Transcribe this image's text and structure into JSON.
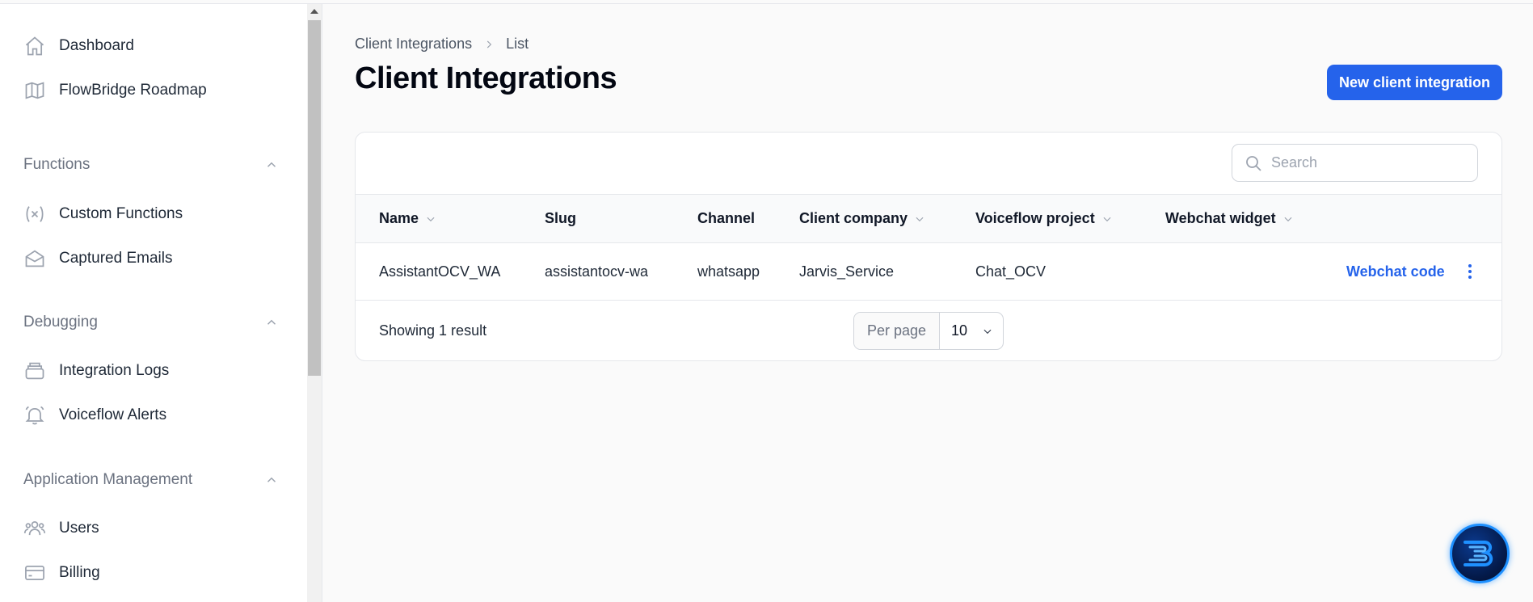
{
  "sidebar": {
    "items_top": [
      {
        "label": "Dashboard",
        "icon": "home-icon"
      },
      {
        "label": "FlowBridge Roadmap",
        "icon": "map-icon"
      }
    ],
    "groups": [
      {
        "title": "Functions",
        "items": [
          {
            "label": "Custom Functions",
            "icon": "variable-icon"
          },
          {
            "label": "Captured Emails",
            "icon": "envelope-open-icon"
          }
        ]
      },
      {
        "title": "Debugging",
        "items": [
          {
            "label": "Integration Logs",
            "icon": "stack-icon"
          },
          {
            "label": "Voiceflow Alerts",
            "icon": "bell-alert-icon"
          }
        ]
      },
      {
        "title": "Application Management",
        "items": [
          {
            "label": "Users",
            "icon": "users-icon"
          },
          {
            "label": "Billing",
            "icon": "credit-card-icon"
          }
        ]
      }
    ]
  },
  "breadcrumb": {
    "parent": "Client Integrations",
    "current": "List"
  },
  "page": {
    "title": "Client Integrations",
    "new_button": "New client integration"
  },
  "search": {
    "placeholder": "Search",
    "value": ""
  },
  "table": {
    "columns": [
      {
        "label": "Name",
        "sortable": true
      },
      {
        "label": "Slug",
        "sortable": false
      },
      {
        "label": "Channel",
        "sortable": false
      },
      {
        "label": "Client company",
        "sortable": true
      },
      {
        "label": "Voiceflow project",
        "sortable": true
      },
      {
        "label": "Webchat widget",
        "sortable": true
      }
    ],
    "rows": [
      {
        "name": "AssistantOCV_WA",
        "slug": "assistantocv-wa",
        "channel": "whatsapp",
        "client_company": "Jarvis_Service",
        "voiceflow_project": "Chat_OCV",
        "webchat_widget": "",
        "action_label": "Webchat code"
      }
    ],
    "footer": {
      "result_text": "Showing 1 result",
      "per_page_label": "Per page",
      "per_page_value": "10"
    }
  },
  "colors": {
    "accent": "#2563eb"
  }
}
